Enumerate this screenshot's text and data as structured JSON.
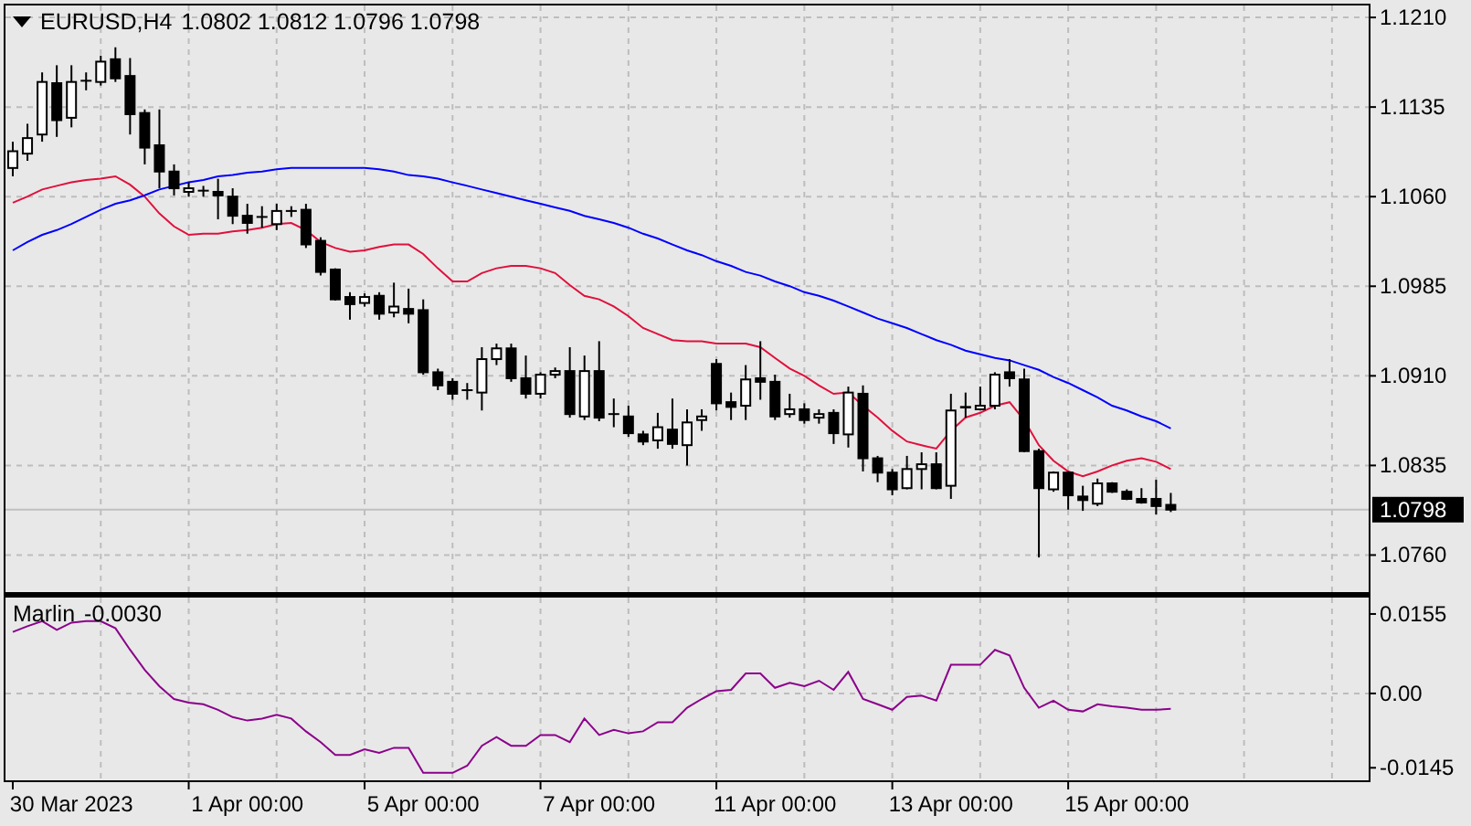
{
  "header": {
    "symbol": "EURUSD,H4",
    "ohlc": "1.0802 1.0812 1.0796 1.0798"
  },
  "price_chart": {
    "chart_data": {
      "type": "candlestick",
      "grid": true,
      "ylim": [
        1.0729,
        1.122
      ],
      "yticks": [
        {
          "value": 1.121,
          "label": "1.1210"
        },
        {
          "value": 1.1135,
          "label": "1.1135"
        },
        {
          "value": 1.106,
          "label": "1.1060"
        },
        {
          "value": 1.0985,
          "label": "1.0985"
        },
        {
          "value": 1.091,
          "label": "1.0910"
        },
        {
          "value": 1.0835,
          "label": "1.0835"
        },
        {
          "value": 1.076,
          "label": "1.0760"
        }
      ],
      "ohlc": [
        [
          1.1084,
          1.1106,
          1.1077,
          1.1098
        ],
        [
          1.1096,
          1.1121,
          1.109,
          1.1109
        ],
        [
          1.1112,
          1.1164,
          1.1106,
          1.1156
        ],
        [
          1.1155,
          1.117,
          1.111,
          1.1124
        ],
        [
          1.1126,
          1.117,
          1.1118,
          1.1156
        ],
        [
          1.1157,
          1.1164,
          1.1149,
          1.1156
        ],
        [
          1.1156,
          1.1178,
          1.1153,
          1.1173
        ],
        [
          1.1175,
          1.1185,
          1.1156,
          1.1159
        ],
        [
          1.1161,
          1.1176,
          1.1112,
          1.1129
        ],
        [
          1.113,
          1.1133,
          1.1087,
          1.1101
        ],
        [
          1.1103,
          1.1133,
          1.1067,
          1.1081
        ],
        [
          1.1081,
          1.1087,
          1.1061,
          1.1067
        ],
        [
          1.1064,
          1.1072,
          1.106,
          1.1067
        ],
        [
          1.1065,
          1.1069,
          1.106,
          1.1064
        ],
        [
          1.1064,
          1.1075,
          1.1041,
          1.1061
        ],
        [
          1.106,
          1.1067,
          1.1037,
          1.1044
        ],
        [
          1.1044,
          1.1054,
          1.1029,
          1.1038
        ],
        [
          1.1043,
          1.1052,
          1.1034,
          1.1043
        ],
        [
          1.1037,
          1.1054,
          1.1032,
          1.1048
        ],
        [
          1.1047,
          1.1052,
          1.1043,
          1.1048
        ],
        [
          1.1049,
          1.1054,
          1.1017,
          1.102
        ],
        [
          1.1023,
          1.1026,
          1.0994,
          1.0997
        ],
        [
          1.0999,
          1.1,
          1.0973,
          1.0974
        ],
        [
          1.0976,
          1.098,
          1.0957,
          1.097
        ],
        [
          1.0971,
          1.0979,
          1.0968,
          1.0976
        ],
        [
          1.0977,
          1.098,
          1.0957,
          1.0962
        ],
        [
          1.0963,
          1.0988,
          1.0959,
          1.0968
        ],
        [
          1.0966,
          1.0983,
          1.0954,
          1.0962
        ],
        [
          1.0965,
          1.0974,
          1.0911,
          1.0913
        ],
        [
          1.0913,
          1.0916,
          1.0898,
          1.0902
        ],
        [
          1.0905,
          1.0908,
          1.089,
          1.0895
        ],
        [
          1.0898,
          1.0904,
          1.089,
          1.0897
        ],
        [
          1.0896,
          1.0934,
          1.0881,
          1.0924
        ],
        [
          1.0924,
          1.0937,
          1.0919,
          1.0933
        ],
        [
          1.0933,
          1.0937,
          1.0905,
          1.0908
        ],
        [
          1.0908,
          1.0927,
          1.0891,
          1.0895
        ],
        [
          1.0895,
          1.0913,
          1.0891,
          1.0911
        ],
        [
          1.0911,
          1.0917,
          1.0908,
          1.0914
        ],
        [
          1.0914,
          1.0934,
          1.0875,
          1.0878
        ],
        [
          1.0876,
          1.0927,
          1.0873,
          1.0914
        ],
        [
          1.0914,
          1.0939,
          1.0872,
          1.0875
        ],
        [
          1.0878,
          1.0891,
          1.0867,
          1.0877
        ],
        [
          1.0876,
          1.0885,
          1.0859,
          1.0862
        ],
        [
          1.0861,
          1.0864,
          1.0852,
          1.0855
        ],
        [
          1.0856,
          1.0879,
          1.0849,
          1.0867
        ],
        [
          1.0865,
          1.0891,
          1.0849,
          1.0853
        ],
        [
          1.0852,
          1.0882,
          1.0835,
          1.0871
        ],
        [
          1.0873,
          1.0882,
          1.0864,
          1.0876
        ],
        [
          1.092,
          1.0924,
          1.0881,
          1.0887
        ],
        [
          1.0888,
          1.0896,
          1.0873,
          1.0884
        ],
        [
          1.0885,
          1.0919,
          1.0873,
          1.0907
        ],
        [
          1.0908,
          1.0939,
          1.089,
          1.0905
        ],
        [
          1.0905,
          1.0911,
          1.0873,
          1.0876
        ],
        [
          1.0878,
          1.0895,
          1.0875,
          1.0882
        ],
        [
          1.0882,
          1.0887,
          1.087,
          1.0873
        ],
        [
          1.0875,
          1.0882,
          1.087,
          1.0878
        ],
        [
          1.0879,
          1.0882,
          1.0853,
          1.0862
        ],
        [
          1.0861,
          1.0901,
          1.085,
          1.0896
        ],
        [
          1.0895,
          1.0902,
          1.083,
          1.0841
        ],
        [
          1.0841,
          1.0843,
          1.0821,
          1.0829
        ],
        [
          1.0829,
          1.0832,
          1.081,
          1.0815
        ],
        [
          1.0816,
          1.0843,
          1.0815,
          1.0832
        ],
        [
          1.0832,
          1.0846,
          1.0815,
          1.0836
        ],
        [
          1.0836,
          1.0846,
          1.0815,
          1.0816
        ],
        [
          1.0818,
          1.0895,
          1.0807,
          1.0881
        ],
        [
          1.0884,
          1.0896,
          1.0875,
          1.0882
        ],
        [
          1.0882,
          1.0901,
          1.0881,
          1.0885
        ],
        [
          1.0885,
          1.0913,
          1.0882,
          1.0911
        ],
        [
          1.0913,
          1.0924,
          1.0901,
          1.0908
        ],
        [
          1.0907,
          1.0916,
          1.0846,
          1.0847
        ],
        [
          1.0847,
          1.0849,
          1.0758,
          1.0816
        ],
        [
          1.0815,
          1.083,
          1.0813,
          1.0829
        ],
        [
          1.0829,
          1.083,
          1.0798,
          1.081
        ],
        [
          1.0809,
          1.0818,
          1.0797,
          1.0806
        ],
        [
          1.0803,
          1.0824,
          1.0801,
          1.082
        ],
        [
          1.082,
          1.0821,
          1.0812,
          1.0813
        ],
        [
          1.0813,
          1.0815,
          1.0806,
          1.0807
        ],
        [
          1.0807,
          1.0816,
          1.0803,
          1.0804
        ],
        [
          1.0807,
          1.0823,
          1.0794,
          1.0801
        ],
        [
          1.0802,
          1.0812,
          1.0796,
          1.0798
        ],
        null,
        null,
        null,
        null,
        null,
        null,
        null,
        null,
        null,
        null,
        null,
        null,
        null
      ],
      "series": [
        {
          "type": "line",
          "color": "#e0103c",
          "values": [
            1.1055,
            1.106,
            1.1066,
            1.1069,
            1.1072,
            1.1074,
            1.1075,
            1.1077,
            1.107,
            1.106,
            1.1046,
            1.1035,
            1.1028,
            1.1029,
            1.1029,
            1.1031,
            1.1032,
            1.1034,
            1.1037,
            1.1038,
            1.1032,
            1.1022,
            1.1017,
            1.1014,
            1.1015,
            1.1018,
            1.102,
            1.102,
            1.1012,
            1.1,
            1.0989,
            1.0989,
            1.0996,
            1.1,
            1.1002,
            1.1002,
            1.1,
            1.0996,
            1.0986,
            1.0977,
            1.0974,
            1.0968,
            1.096,
            1.095,
            1.0945,
            1.094,
            1.0939,
            1.0939,
            1.0937,
            1.0937,
            1.0937,
            1.0934,
            1.0925,
            1.0916,
            1.091,
            1.0902,
            1.0895,
            1.0896,
            1.0885,
            1.0875,
            1.0864,
            1.0855,
            1.0852,
            1.0849,
            1.0864,
            1.0875,
            1.0879,
            1.0885,
            1.0888,
            1.0873,
            1.0852,
            1.0839,
            1.083,
            1.0826,
            1.083,
            1.0835,
            1.0839,
            1.0841,
            1.0838,
            1.0832,
            null,
            null,
            null,
            null,
            null,
            null,
            null,
            null,
            null,
            null,
            null,
            null,
            null
          ]
        },
        {
          "type": "line",
          "color": "#0000ff",
          "values": [
            1.1015,
            1.1022,
            1.1028,
            1.1032,
            1.1037,
            1.1043,
            1.1049,
            1.1054,
            1.1057,
            1.1061,
            1.1066,
            1.1069,
            1.1072,
            1.1074,
            1.1077,
            1.1078,
            1.108,
            1.1081,
            1.1083,
            1.1084,
            1.1084,
            1.1084,
            1.1084,
            1.1084,
            1.1084,
            1.1083,
            1.1081,
            1.1078,
            1.1077,
            1.1075,
            1.1072,
            1.1069,
            1.1066,
            1.1063,
            1.106,
            1.1057,
            1.1054,
            1.1051,
            1.1048,
            1.1044,
            1.1041,
            1.1038,
            1.1034,
            1.1029,
            1.1025,
            1.102,
            1.1015,
            1.1011,
            1.1006,
            1.1002,
            1.0997,
            1.0994,
            1.0989,
            1.0985,
            1.098,
            1.0977,
            1.0973,
            1.0968,
            1.0963,
            1.0958,
            1.0954,
            1.095,
            1.0945,
            1.094,
            1.0936,
            1.0931,
            1.0928,
            1.0925,
            1.0923,
            1.0919,
            1.0915,
            1.0909,
            1.0904,
            1.0898,
            1.0892,
            1.0885,
            1.0881,
            1.0876,
            1.0872,
            1.0866,
            null,
            null,
            null,
            null,
            null,
            null,
            null,
            null,
            null,
            null,
            null,
            null,
            null
          ]
        }
      ],
      "ref_lines": [
        {
          "axis": "y",
          "value": 1.0798,
          "label": "1.0798"
        }
      ]
    }
  },
  "indicator": {
    "reading": "-0.0030",
    "chart_data": {
      "type": "line",
      "grid": true,
      "ylim": [
        -0.0173,
        0.0187
      ],
      "categories": [
        null,
        null,
        null,
        null,
        "30 Mar 2023",
        null,
        null,
        null,
        null,
        null,
        null,
        null,
        null,
        null,
        null,
        null,
        "1 Apr 00:00",
        null,
        null,
        null,
        null,
        null,
        null,
        null,
        null,
        null,
        null,
        null,
        "5 Apr 00:00",
        null,
        null,
        null,
        null,
        null,
        null,
        null,
        null,
        null,
        null,
        null,
        "7 Apr 00:00",
        null,
        null,
        null,
        null,
        null,
        null,
        null,
        null,
        null,
        null,
        null,
        "11 Apr 00:00",
        null,
        null,
        null,
        null,
        null,
        null,
        null,
        null,
        null,
        null,
        null,
        "13 Apr 00:00",
        null,
        null,
        null,
        null,
        null,
        null,
        null,
        null,
        null,
        null,
        null,
        "15 Apr 00:00",
        null,
        null,
        null,
        null,
        null,
        null,
        null,
        null,
        null,
        null,
        null,
        null,
        null,
        null,
        null,
        null
      ],
      "yticks": [
        {
          "value": 0.0155,
          "label": "0.0155"
        },
        {
          "value": 0,
          "label": "0.00"
        },
        {
          "value": -0.0145,
          "label": "-0.0145"
        }
      ],
      "series": [
        {
          "name": "Marlin",
          "color": "#8b008b",
          "values": [
            0.012,
            0.0131,
            0.0141,
            0.0124,
            0.0138,
            0.0141,
            0.0141,
            0.0127,
            0.0085,
            0.0046,
            0.0014,
            -0.0011,
            -0.0018,
            -0.0021,
            -0.0032,
            -0.0046,
            -0.0053,
            -0.0049,
            -0.0042,
            -0.0049,
            -0.0074,
            -0.0095,
            -0.012,
            -0.012,
            -0.0109,
            -0.0116,
            -0.0106,
            -0.0106,
            -0.0155,
            -0.0155,
            -0.0155,
            -0.0141,
            -0.0102,
            -0.0085,
            -0.0102,
            -0.0102,
            -0.0081,
            -0.0081,
            -0.0095,
            -0.0049,
            -0.0081,
            -0.0071,
            -0.0078,
            -0.0074,
            -0.0056,
            -0.0056,
            -0.0028,
            -0.0011,
            0.0004,
            0.0007,
            0.0039,
            0.0039,
            0.0011,
            0.0021,
            0.0014,
            0.0025,
            0.0007,
            0.0042,
            -0.0011,
            -0.0021,
            -0.0032,
            -0.0007,
            -0.0004,
            -0.0014,
            0.0056,
            0.0056,
            0.0056,
            0.0085,
            0.0074,
            0.0011,
            -0.0028,
            -0.0014,
            -0.0032,
            -0.0035,
            -0.0021,
            -0.0025,
            -0.0028,
            -0.0032,
            -0.0032,
            -0.003,
            null,
            null,
            null,
            null,
            null,
            null,
            null,
            null,
            null,
            null,
            null,
            null,
            null
          ]
        }
      ]
    }
  }
}
